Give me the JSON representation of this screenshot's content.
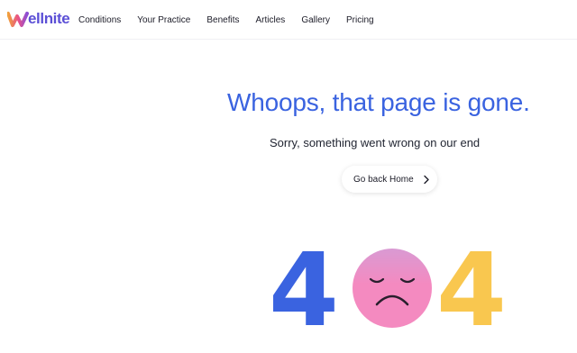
{
  "brand": {
    "name": "ellnite",
    "logo_colors": [
      "#f0a13c",
      "#e8508a",
      "#5b4fd6"
    ]
  },
  "nav": {
    "items": [
      {
        "label": "Conditions"
      },
      {
        "label": "Your Practice"
      },
      {
        "label": "Benefits"
      },
      {
        "label": "Articles"
      },
      {
        "label": "Gallery"
      },
      {
        "label": "Pricing"
      }
    ]
  },
  "hero": {
    "headline": "Whoops, that page is gone.",
    "subheadline": "Sorry, something went wrong on our end",
    "button_label": "Go back Home",
    "button_icon": "chevron-right-icon"
  },
  "error_art": {
    "digit_left": "4",
    "digit_right": "4",
    "face_icon": "sad-face-icon",
    "colors": {
      "left_digit": "#3a63e0",
      "right_digit": "#f9c74f",
      "face": "#f48ac0",
      "face_top": "#d99ad3"
    }
  },
  "colors": {
    "accent": "#3a63e0",
    "text": "#1c1c28"
  }
}
